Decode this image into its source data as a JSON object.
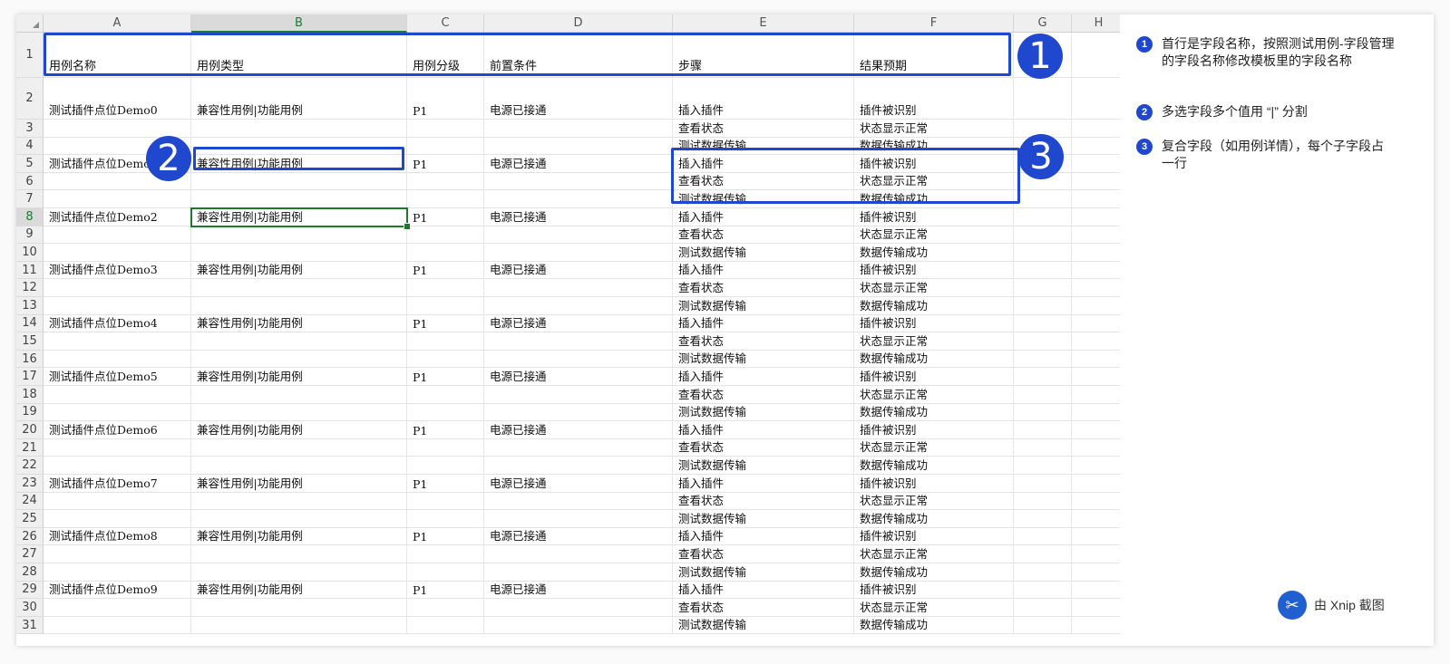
{
  "columns": [
    "A",
    "B",
    "C",
    "D",
    "E",
    "F",
    "G",
    "H"
  ],
  "selected_column": "B",
  "selected_row": "8",
  "header_row": {
    "row_number": "1",
    "cells": [
      "用例名称",
      "用例类型",
      "用例分级",
      "前置条件",
      "步骤",
      "结果预期",
      "",
      ""
    ]
  },
  "rows": [
    {
      "n": "2",
      "cells": [
        "测试插件点位Demo0",
        "兼容性用例|功能用例",
        "P1",
        "电源已接通",
        "插入插件",
        "插件被识别",
        "",
        ""
      ]
    },
    {
      "n": "3",
      "cells": [
        "",
        "",
        "",
        "",
        "查看状态",
        "状态显示正常",
        "",
        ""
      ]
    },
    {
      "n": "4",
      "cells": [
        "",
        "",
        "",
        "",
        "测试数据传输",
        "数据传输成功",
        "",
        ""
      ]
    },
    {
      "n": "5",
      "cells": [
        "测试插件点位Demo1",
        "兼容性用例|功能用例",
        "P1",
        "电源已接通",
        "插入插件",
        "插件被识别",
        "",
        ""
      ]
    },
    {
      "n": "6",
      "cells": [
        "",
        "",
        "",
        "",
        "查看状态",
        "状态显示正常",
        "",
        ""
      ]
    },
    {
      "n": "7",
      "cells": [
        "",
        "",
        "",
        "",
        "测试数据传输",
        "数据传输成功",
        "",
        ""
      ]
    },
    {
      "n": "8",
      "cells": [
        "测试插件点位Demo2",
        "兼容性用例|功能用例",
        "P1",
        "电源已接通",
        "插入插件",
        "插件被识别",
        "",
        ""
      ]
    },
    {
      "n": "9",
      "cells": [
        "",
        "",
        "",
        "",
        "查看状态",
        "状态显示正常",
        "",
        ""
      ]
    },
    {
      "n": "10",
      "cells": [
        "",
        "",
        "",
        "",
        "测试数据传输",
        "数据传输成功",
        "",
        ""
      ]
    },
    {
      "n": "11",
      "cells": [
        "测试插件点位Demo3",
        "兼容性用例|功能用例",
        "P1",
        "电源已接通",
        "插入插件",
        "插件被识别",
        "",
        ""
      ]
    },
    {
      "n": "12",
      "cells": [
        "",
        "",
        "",
        "",
        "查看状态",
        "状态显示正常",
        "",
        ""
      ]
    },
    {
      "n": "13",
      "cells": [
        "",
        "",
        "",
        "",
        "测试数据传输",
        "数据传输成功",
        "",
        ""
      ]
    },
    {
      "n": "14",
      "cells": [
        "测试插件点位Demo4",
        "兼容性用例|功能用例",
        "P1",
        "电源已接通",
        "插入插件",
        "插件被识别",
        "",
        ""
      ]
    },
    {
      "n": "15",
      "cells": [
        "",
        "",
        "",
        "",
        "查看状态",
        "状态显示正常",
        "",
        ""
      ]
    },
    {
      "n": "16",
      "cells": [
        "",
        "",
        "",
        "",
        "测试数据传输",
        "数据传输成功",
        "",
        ""
      ]
    },
    {
      "n": "17",
      "cells": [
        "测试插件点位Demo5",
        "兼容性用例|功能用例",
        "P1",
        "电源已接通",
        "插入插件",
        "插件被识别",
        "",
        ""
      ]
    },
    {
      "n": "18",
      "cells": [
        "",
        "",
        "",
        "",
        "查看状态",
        "状态显示正常",
        "",
        ""
      ]
    },
    {
      "n": "19",
      "cells": [
        "",
        "",
        "",
        "",
        "测试数据传输",
        "数据传输成功",
        "",
        ""
      ]
    },
    {
      "n": "20",
      "cells": [
        "测试插件点位Demo6",
        "兼容性用例|功能用例",
        "P1",
        "电源已接通",
        "插入插件",
        "插件被识别",
        "",
        ""
      ]
    },
    {
      "n": "21",
      "cells": [
        "",
        "",
        "",
        "",
        "查看状态",
        "状态显示正常",
        "",
        ""
      ]
    },
    {
      "n": "22",
      "cells": [
        "",
        "",
        "",
        "",
        "测试数据传输",
        "数据传输成功",
        "",
        ""
      ]
    },
    {
      "n": "23",
      "cells": [
        "测试插件点位Demo7",
        "兼容性用例|功能用例",
        "P1",
        "电源已接通",
        "插入插件",
        "插件被识别",
        "",
        ""
      ]
    },
    {
      "n": "24",
      "cells": [
        "",
        "",
        "",
        "",
        "查看状态",
        "状态显示正常",
        "",
        ""
      ]
    },
    {
      "n": "25",
      "cells": [
        "",
        "",
        "",
        "",
        "测试数据传输",
        "数据传输成功",
        "",
        ""
      ]
    },
    {
      "n": "26",
      "cells": [
        "测试插件点位Demo8",
        "兼容性用例|功能用例",
        "P1",
        "电源已接通",
        "插入插件",
        "插件被识别",
        "",
        ""
      ]
    },
    {
      "n": "27",
      "cells": [
        "",
        "",
        "",
        "",
        "查看状态",
        "状态显示正常",
        "",
        ""
      ]
    },
    {
      "n": "28",
      "cells": [
        "",
        "",
        "",
        "",
        "测试数据传输",
        "数据传输成功",
        "",
        ""
      ]
    },
    {
      "n": "29",
      "cells": [
        "测试插件点位Demo9",
        "兼容性用例|功能用例",
        "P1",
        "电源已接通",
        "插入插件",
        "插件被识别",
        "",
        ""
      ]
    },
    {
      "n": "30",
      "cells": [
        "",
        "",
        "",
        "",
        "查看状态",
        "状态显示正常",
        "",
        ""
      ]
    },
    {
      "n": "31",
      "cells": [
        "",
        "",
        "",
        "",
        "测试数据传输",
        "数据传输成功",
        "",
        ""
      ]
    }
  ],
  "callouts": [
    {
      "number": "1"
    },
    {
      "number": "2"
    },
    {
      "number": "3"
    }
  ],
  "notes": [
    {
      "number": "1",
      "text": "首行是字段名称，按照测试用例-字段管理的字段名称修改模板里的字段名称"
    },
    {
      "number": "2",
      "text": "多选字段多个值用 “|” 分割"
    },
    {
      "number": "3",
      "text": "复合字段（如用例详情），每个子字段占一行"
    }
  ],
  "watermark": {
    "text": "由 Xnip 截图",
    "icon": "xnip-logo-icon"
  },
  "colors": {
    "accent": "#1f48cf",
    "selection": "#1d7a2d",
    "header_bg": "#efefef"
  }
}
